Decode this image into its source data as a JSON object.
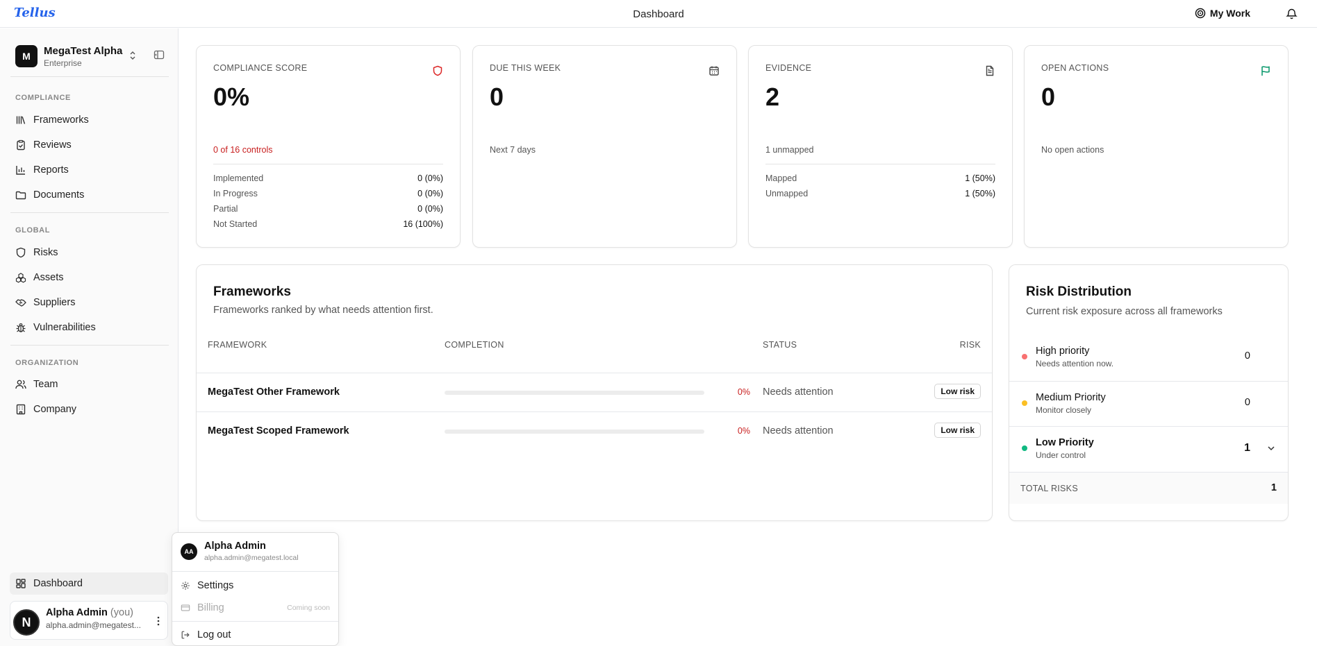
{
  "app": {
    "logo": "Tellus",
    "title": "Dashboard",
    "my_work": "My Work"
  },
  "colors": {
    "danger": "#dc2626",
    "success": "#059669",
    "high": "#f87171",
    "medium": "#fbbf24",
    "low": "#10b981"
  },
  "org": {
    "initial": "M",
    "name": "MegaTest Alpha",
    "plan": "Enterprise"
  },
  "sidebar": {
    "sections": [
      {
        "title": "COMPLIANCE",
        "items": [
          {
            "label": "Frameworks",
            "icon": "library-icon"
          },
          {
            "label": "Reviews",
            "icon": "clipboard-check-icon"
          },
          {
            "label": "Reports",
            "icon": "bar-chart-icon"
          },
          {
            "label": "Documents",
            "icon": "folder-icon"
          }
        ]
      },
      {
        "title": "GLOBAL",
        "items": [
          {
            "label": "Risks",
            "icon": "shield-icon"
          },
          {
            "label": "Assets",
            "icon": "boxes-icon"
          },
          {
            "label": "Suppliers",
            "icon": "handshake-icon"
          },
          {
            "label": "Vulnerabilities",
            "icon": "bug-icon"
          }
        ]
      },
      {
        "title": "ORGANIZATION",
        "items": [
          {
            "label": "Team",
            "icon": "users-icon"
          },
          {
            "label": "Company",
            "icon": "building-icon"
          }
        ]
      }
    ],
    "bottom_item": {
      "label": "Dashboard",
      "icon": "dashboard-icon"
    }
  },
  "user": {
    "name": "Alpha Admin",
    "you": "(you)",
    "email": "alpha.admin@megatest.local",
    "email_short": "alpha.admin@megatest...",
    "avatar_letter": "N",
    "initials": "AA"
  },
  "stats": {
    "compliance": {
      "label": "COMPLIANCE SCORE",
      "value": "0%",
      "note": "0 of 16 controls",
      "rows": [
        {
          "k": "Implemented",
          "v": "0 (0%)"
        },
        {
          "k": "In Progress",
          "v": "0 (0%)"
        },
        {
          "k": "Partial",
          "v": "0 (0%)"
        },
        {
          "k": "Not Started",
          "v": "16 (100%)"
        }
      ]
    },
    "due": {
      "label": "DUE THIS WEEK",
      "value": "0",
      "note": "Next 7 days"
    },
    "evidence": {
      "label": "EVIDENCE",
      "value": "2",
      "note": "1 unmapped",
      "rows": [
        {
          "k": "Mapped",
          "v": "1 (50%)"
        },
        {
          "k": "Unmapped",
          "v": "1 (50%)"
        }
      ]
    },
    "actions": {
      "label": "OPEN ACTIONS",
      "value": "0",
      "note": "No open actions"
    }
  },
  "frameworks": {
    "title": "Frameworks",
    "subtitle": "Frameworks ranked by what needs attention first.",
    "columns": {
      "framework": "FRAMEWORK",
      "completion": "COMPLETION",
      "status": "STATUS",
      "risk": "RISK"
    },
    "rows": [
      {
        "name": "MegaTest Other Framework",
        "completion": 0,
        "pct": "0%",
        "status": "Needs attention",
        "risk": "Low risk"
      },
      {
        "name": "MegaTest Scoped Framework",
        "completion": 0,
        "pct": "0%",
        "status": "Needs attention",
        "risk": "Low risk"
      }
    ]
  },
  "risk_distribution": {
    "title": "Risk Distribution",
    "subtitle": "Current risk exposure across all frameworks",
    "rows": [
      {
        "name": "High priority",
        "desc": "Needs attention now.",
        "count": "0"
      },
      {
        "name": "Medium Priority",
        "desc": "Monitor closely",
        "count": "0"
      },
      {
        "name": "Low Priority",
        "desc": "Under control",
        "count": "1"
      }
    ],
    "total_label": "TOTAL RISKS",
    "total": "1"
  },
  "menu": {
    "settings": "Settings",
    "billing": "Billing",
    "billing_note": "Coming soon",
    "logout": "Log out"
  }
}
